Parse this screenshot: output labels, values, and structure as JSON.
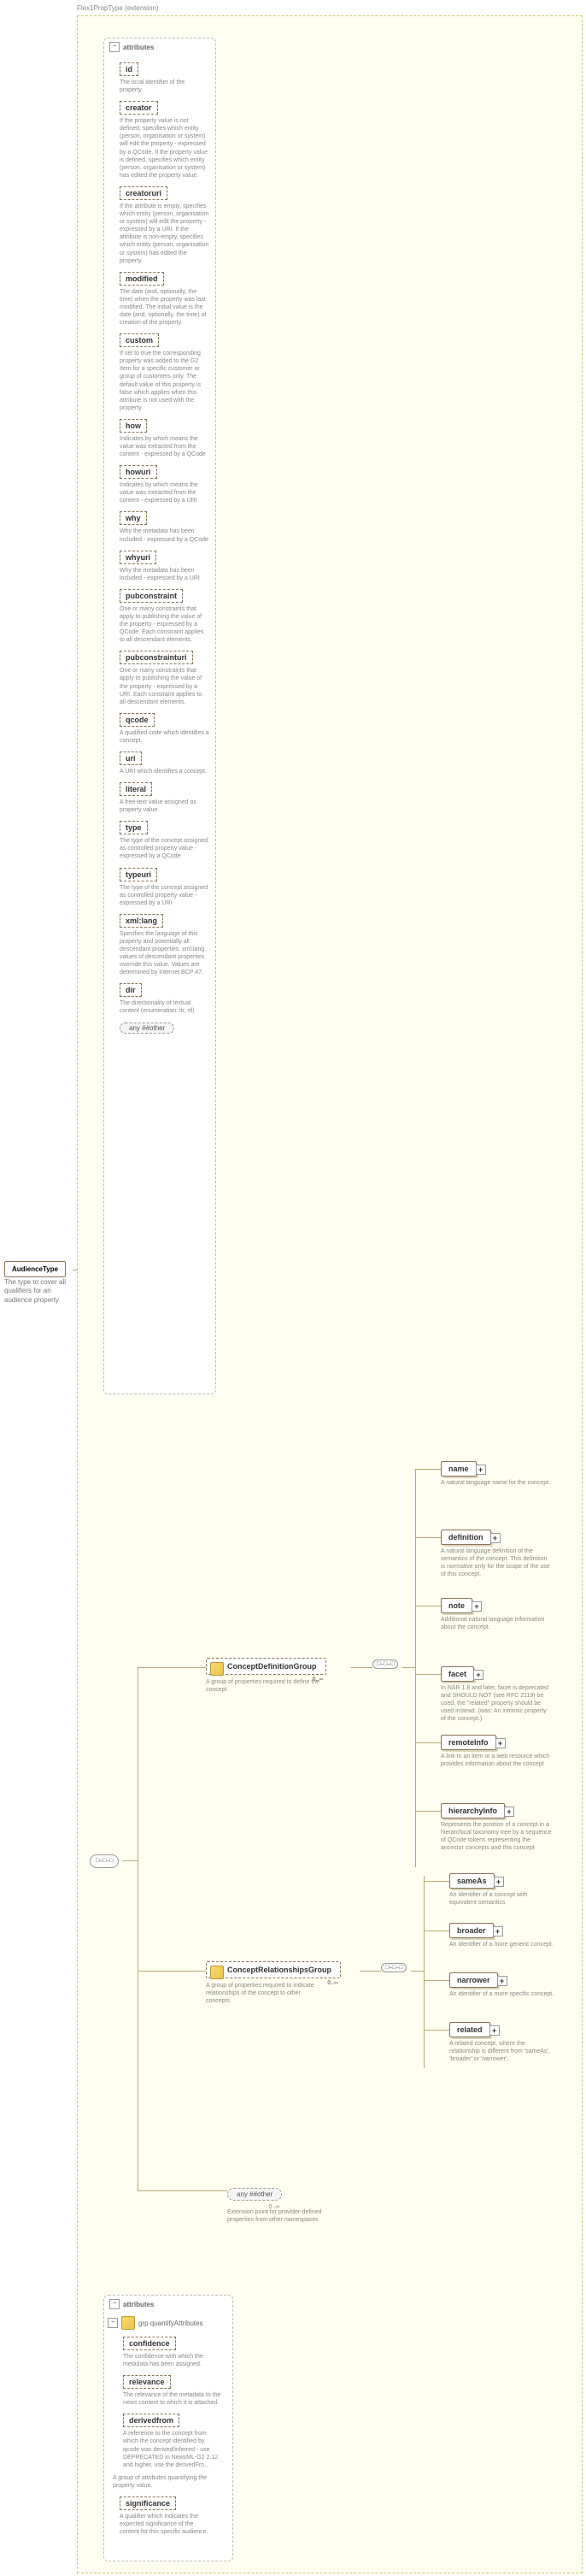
{
  "root": {
    "name": "AudienceType",
    "desc": "The type to cover all qualifiers for an audience property"
  },
  "ext_header": "Flex1PropType (extension)",
  "attr1": {
    "header": "attributes",
    "items": [
      {
        "name": "id",
        "desc": "The local identifier of the property."
      },
      {
        "name": "creator",
        "desc": "If the property value is not defined, specifies which entity (person, organisation or system) will edit the property - expressed by a QCode. If the property value is defined, specifies which entity (person, organisation or system) has edited the property value."
      },
      {
        "name": "creatoruri",
        "desc": "If the attribute is empty, specifies which entity (person, organisation or system) will edit the property - expressed by a URI. If the attribute is non-empty, specifies which entity (person, organisation or system) has edited the property."
      },
      {
        "name": "modified",
        "desc": "The date (and, optionally, the time) when the property was last modified. The initial value is the date (and, optionally, the time) of creation of the property."
      },
      {
        "name": "custom",
        "desc": "If set to true the corresponding property was added to the G2 Item for a specific customer or group of customers only. The default value of this property is false which applies when this attribute is not used with the property."
      },
      {
        "name": "how",
        "desc": "Indicates by which means the value was extracted from the content - expressed by a QCode"
      },
      {
        "name": "howuri",
        "desc": "Indicates by which means the value was extracted from the content - expressed by a URI"
      },
      {
        "name": "why",
        "desc": "Why the metadata has been included - expressed by a QCode"
      },
      {
        "name": "whyuri",
        "desc": "Why the metadata has been included - expressed by a URI"
      },
      {
        "name": "pubconstraint",
        "desc": "One or many constraints that apply to publishing the value of the property - expressed by a QCode. Each constraint applies to all descendant elements."
      },
      {
        "name": "pubconstrainturi",
        "desc": "One or many constraints that apply to publishing the value of the property - expressed by a URI. Each constraint applies to all descendant elements."
      },
      {
        "name": "qcode",
        "desc": "A qualified code which identifies a concept."
      },
      {
        "name": "uri",
        "desc": "A URI which identifies a concept."
      },
      {
        "name": "literal",
        "desc": "A free-text value assigned as property value."
      },
      {
        "name": "type",
        "desc": "The type of the concept assigned as controlled property value - expressed by a QCode"
      },
      {
        "name": "typeuri",
        "desc": "The type of the concept assigned as controlled property value - expressed by a URI"
      },
      {
        "name": "xml:lang",
        "desc": "Specifies the language of this property and potentially all descendant properties. xml:lang values of descendant properties override this value. Values are determined by Internet BCP 47."
      },
      {
        "name": "dir",
        "desc": "The directionality of textual content (enumeration: ltr, rtl)"
      }
    ],
    "any": "any ##other"
  },
  "seq_symbol": "□–□–□",
  "groups": {
    "cdg": {
      "name": "ConceptDefinitionGroup",
      "desc": "A group of properties required to define the concept",
      "card": "0..∞"
    },
    "crg": {
      "name": "ConceptRelationshipsGroup",
      "desc": "A group of properties required to indicate relationships of the concept to other concepts",
      "card": "0..∞"
    },
    "any": {
      "label": "any ##other",
      "desc": "Extension point for provider-defined properties from other namespaces",
      "card": "0..∞"
    }
  },
  "cdg_children": [
    {
      "name": "name",
      "desc": "A natural language name for the concept."
    },
    {
      "name": "definition",
      "desc": "A natural language definition of the semantics of the concept. This definition is normative only for the scope of the use of this concept."
    },
    {
      "name": "note",
      "desc": "Additional natural language information about the concept."
    },
    {
      "name": "facet",
      "desc": "In NAR 1.8 and later, facet is deprecated and SHOULD NOT (see RFC 2119) be used, the \"related\" property should be used instead. (was: An intrinsic property of the concept.)"
    },
    {
      "name": "remoteInfo",
      "desc": "A link to an item or a web resource which provides information about the concept"
    },
    {
      "name": "hierarchyInfo",
      "desc": "Represents the position of a concept in a hierarchical taxonomy tree by a sequence of QCode tokens representing the ancestor concepts and this concept"
    }
  ],
  "crg_children": [
    {
      "name": "sameAs",
      "desc": "An identifier of a concept with equivalent semantics"
    },
    {
      "name": "broader",
      "desc": "An identifier of a more generic concept."
    },
    {
      "name": "narrower",
      "desc": "An identifier of a more specific concept."
    },
    {
      "name": "related",
      "desc": "A related concept, where the relationship is different from 'sameAs', 'broader' or 'narrower'."
    }
  ],
  "attr2": {
    "header": "attributes",
    "ghdr": "grp quantifyAttributes",
    "items": [
      {
        "name": "confidence",
        "desc": "The confidence with which the metadata has been assigned."
      },
      {
        "name": "relevance",
        "desc": "The relevance of the metadata to the news content to which it is attached."
      },
      {
        "name": "derivedfrom",
        "desc": "A reference to the concept from which the concept identified by qcode was derived/inferred - use DEPRECATED in NewsML-G2 2.12 and higher, use the derivedFro..."
      }
    ],
    "gdesc": "A group of attributes quantifying the property value.",
    "sig": {
      "name": "significance",
      "desc": "A qualifier which indicates the expected significance of the content for this specific audience."
    }
  },
  "chart_data": {
    "type": "diagram"
  }
}
